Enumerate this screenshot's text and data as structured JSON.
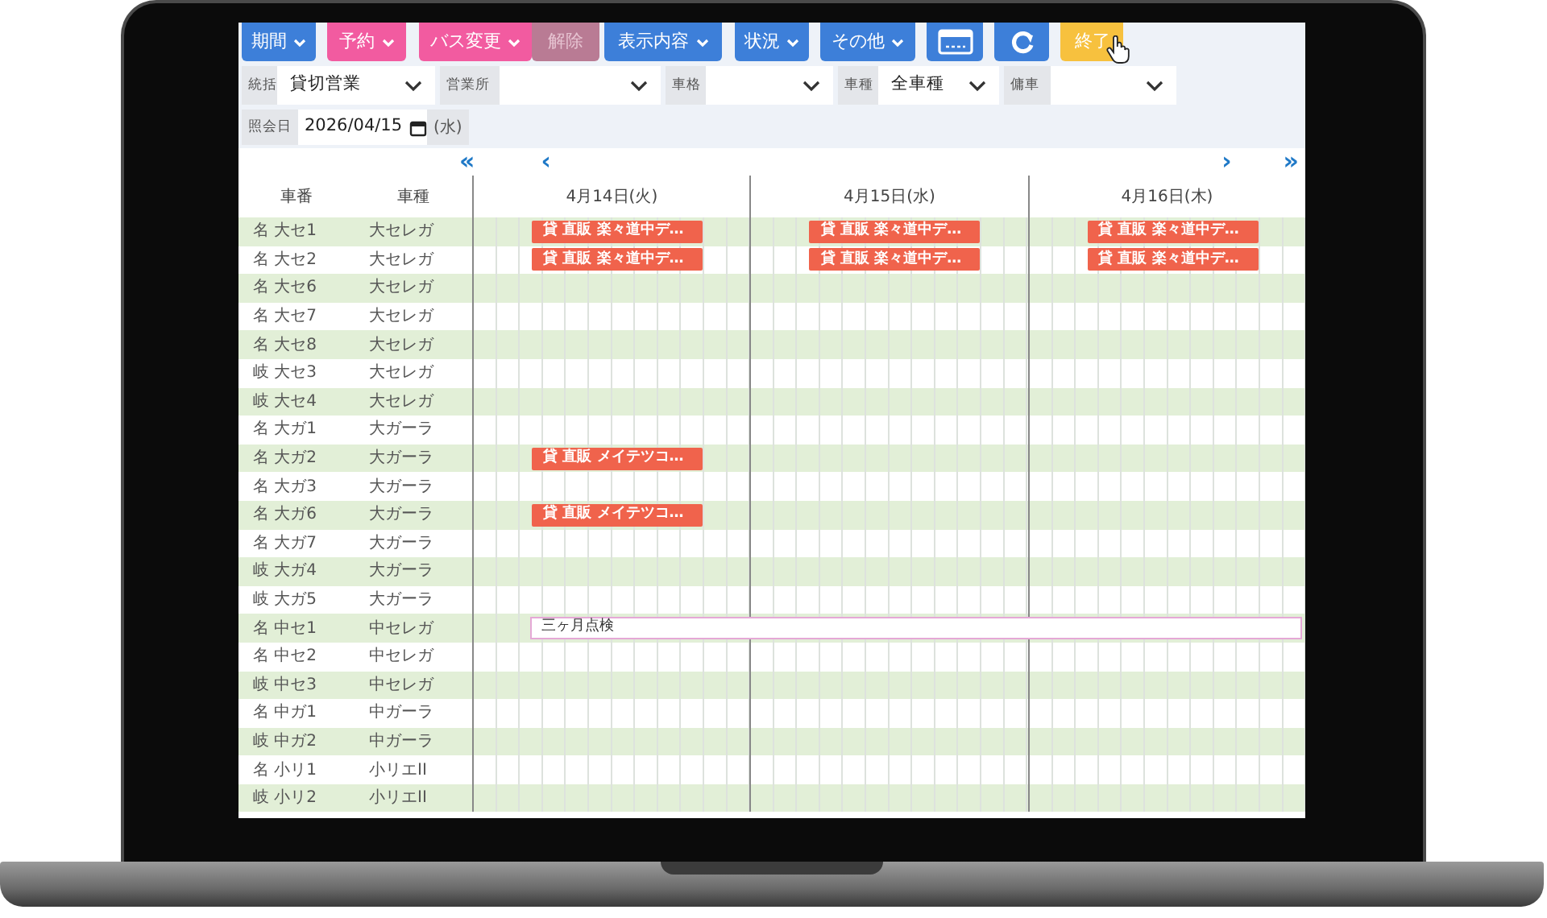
{
  "toolbar": [
    {
      "kind": "text",
      "label": "期間",
      "color": "#3d7fd9",
      "dropdown": true,
      "disabled": false
    },
    {
      "kind": "text",
      "label": "予約",
      "color": "#f25ba0",
      "dropdown": true,
      "disabled": false
    },
    {
      "kind": "text",
      "label": "バス変更",
      "color": "#f25ba0",
      "dropdown": true,
      "disabled": false
    },
    {
      "kind": "text",
      "label": "解除",
      "color": "#b97b94",
      "dropdown": false,
      "disabled": true
    },
    {
      "kind": "text",
      "label": "表示内容",
      "color": "#3d7fd9",
      "dropdown": true,
      "disabled": false
    },
    {
      "kind": "text",
      "label": "状況",
      "color": "#3d7fd9",
      "dropdown": true,
      "disabled": false
    },
    {
      "kind": "text",
      "label": "その他",
      "color": "#3d7fd9",
      "dropdown": true,
      "disabled": false
    },
    {
      "kind": "card",
      "color": "#3d7fd9",
      "disabled": false
    },
    {
      "kind": "refresh",
      "color": "#3d7fd9",
      "disabled": false
    },
    {
      "kind": "text",
      "label": "終了",
      "color": "#f7c13e",
      "dropdown": false,
      "disabled": false,
      "hovered": true
    }
  ],
  "filters": [
    {
      "label": "統括",
      "value": "貸切営業"
    },
    {
      "label": "営業所"
    },
    {
      "label": "車格"
    },
    {
      "label": "車種",
      "value": "全車種"
    },
    {
      "label": "傭車"
    }
  ],
  "date": {
    "label": "照会日",
    "value": "2026/04/15",
    "weekday": "(水)"
  },
  "nav": {
    "first": "«",
    "prev": "‹",
    "next": "›",
    "last": "»"
  },
  "columns": [
    "車番",
    "車種"
  ],
  "days": [
    "4月14日(火)",
    "4月15日(水)",
    "4月16日(木)"
  ],
  "rows": [
    {
      "number": "名 大セ1",
      "type": "大セレガ",
      "days": [
        {
          "kind": "booking",
          "text": "貸 直販 楽々道中デ…"
        },
        {
          "kind": "booking",
          "text": "貸 直販 楽々道中デ…"
        },
        {
          "kind": "booking",
          "text": "貸 直販 楽々道中デ…"
        }
      ]
    },
    {
      "number": "名 大セ2",
      "type": "大セレガ",
      "days": [
        {
          "kind": "booking",
          "text": "貸 直販 楽々道中デ…"
        },
        {
          "kind": "booking",
          "text": "貸 直販 楽々道中デ…"
        },
        {
          "kind": "booking",
          "text": "貸 直販 楽々道中デ…"
        }
      ]
    },
    {
      "number": "名 大セ6",
      "type": "大セレガ"
    },
    {
      "number": "名 大セ7",
      "type": "大セレガ"
    },
    {
      "number": "名 大セ8",
      "type": "大セレガ"
    },
    {
      "number": "岐 大セ3",
      "type": "大セレガ"
    },
    {
      "number": "岐 大セ4",
      "type": "大セレガ"
    },
    {
      "number": "名 大ガ1",
      "type": "大ガーラ"
    },
    {
      "number": "名 大ガ2",
      "type": "大ガーラ",
      "days": [
        {
          "kind": "booking",
          "text": "貸 直販 メイテツコ…"
        }
      ]
    },
    {
      "number": "名 大ガ3",
      "type": "大ガーラ"
    },
    {
      "number": "名 大ガ6",
      "type": "大ガーラ",
      "days": [
        {
          "kind": "booking",
          "text": "貸 直販 メイテツコ…"
        }
      ]
    },
    {
      "number": "名 大ガ7",
      "type": "大ガーラ"
    },
    {
      "number": "岐 大ガ4",
      "type": "大ガーラ"
    },
    {
      "number": "岐 大ガ5",
      "type": "大ガーラ"
    },
    {
      "number": "名 中セ1",
      "type": "中セレガ",
      "days": [
        {
          "kind": "inspection",
          "text": "三ヶ月点検"
        }
      ]
    },
    {
      "number": "名 中セ2",
      "type": "中セレガ"
    },
    {
      "number": "岐 中セ3",
      "type": "中セレガ"
    },
    {
      "number": "名 中ガ1",
      "type": "中ガーラ"
    },
    {
      "number": "岐 中ガ2",
      "type": "中ガーラ"
    },
    {
      "number": "名 小リ1",
      "type": "小リエII"
    },
    {
      "number": "岐 小リ2",
      "type": "小リエII"
    }
  ]
}
